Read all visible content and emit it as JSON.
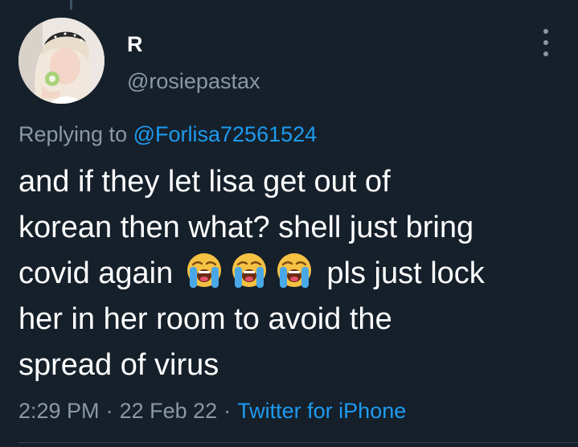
{
  "user": {
    "display_name": "R",
    "handle": "@rosiepastax"
  },
  "reply": {
    "prefix": "Replying to ",
    "mention": "@Forlisa72561524"
  },
  "tweet": {
    "lines": [
      "and if they let lisa get out of",
      "korean then what? shell just bring",
      "covid again",
      "pls just lock",
      "her in her room to avoid the",
      "spread of virus"
    ],
    "emoji_name": "loudly-crying-face",
    "emoji_count": 3
  },
  "meta": {
    "time": "2:29 PM",
    "separator": "·",
    "date": "22 Feb 22",
    "source": "Twitter for iPhone"
  },
  "colors": {
    "background": "#15202b",
    "text": "#ffffff",
    "muted": "#8b98a5",
    "accent": "#1d9bf0"
  },
  "icons": {
    "more": "more-options-icon",
    "emoji": "loudly-crying-face-icon"
  }
}
